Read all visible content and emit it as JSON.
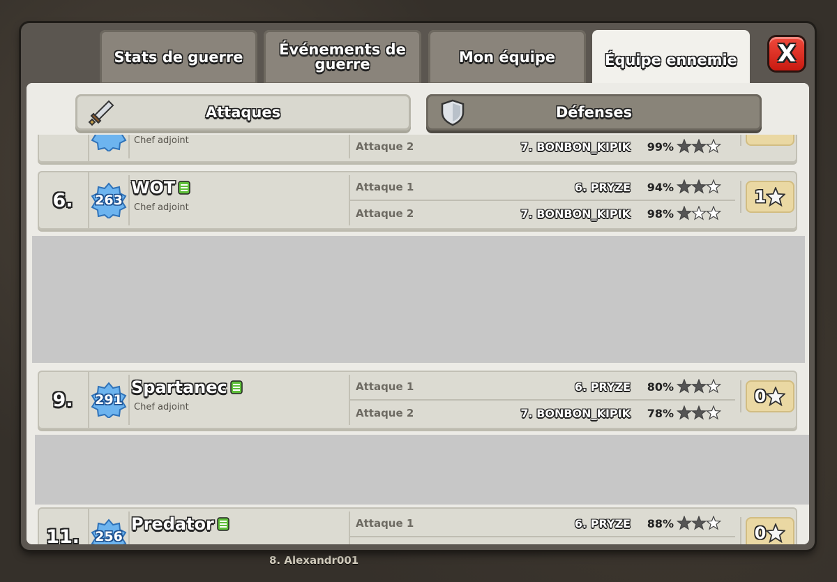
{
  "tabs": [
    {
      "label": "Stats de guerre",
      "active": false
    },
    {
      "label": "Événements de guerre",
      "active": false
    },
    {
      "label": "Mon équipe",
      "active": false
    },
    {
      "label": "Équipe ennemie",
      "active": true
    }
  ],
  "close_label": "X",
  "subtabs": {
    "attacks": "Attaques",
    "defenses": "Défenses"
  },
  "background_caption": "8. Alexandr001",
  "rows": [
    {
      "rank": "",
      "badge": "",
      "name": "",
      "role": "Chef adjoint",
      "attacks": [
        {
          "label": "Attaque 2",
          "target": "7. BONBON_KIPIK",
          "percent": "99%",
          "stars": 2
        }
      ],
      "score": ""
    },
    {
      "rank": "6.",
      "badge": "263",
      "name": "WOT",
      "role": "Chef adjoint",
      "attacks": [
        {
          "label": "Attaque 1",
          "target": "6. PRYZE",
          "percent": "94%",
          "stars": 2
        },
        {
          "label": "Attaque 2",
          "target": "7. BONBON_KIPIK",
          "percent": "98%",
          "stars": 1
        }
      ],
      "score": "1"
    },
    {
      "rank": "9.",
      "badge": "291",
      "name": "Spartanec",
      "role": "Chef adjoint",
      "attacks": [
        {
          "label": "Attaque 1",
          "target": "6. PRYZE",
          "percent": "80%",
          "stars": 2
        },
        {
          "label": "Attaque 2",
          "target": "7. BONBON_KIPIK",
          "percent": "78%",
          "stars": 2
        }
      ],
      "score": "0"
    },
    {
      "rank": "11.",
      "badge": "256",
      "name": "Predator",
      "role": "",
      "attacks": [
        {
          "label": "Attaque 1",
          "target": "6. PRYZE",
          "percent": "88%",
          "stars": 2
        }
      ],
      "score": "0"
    }
  ],
  "colors": {
    "star_filled": "#555555",
    "star_empty": "#ffffff",
    "badge_blue": "#4fa3e6"
  }
}
